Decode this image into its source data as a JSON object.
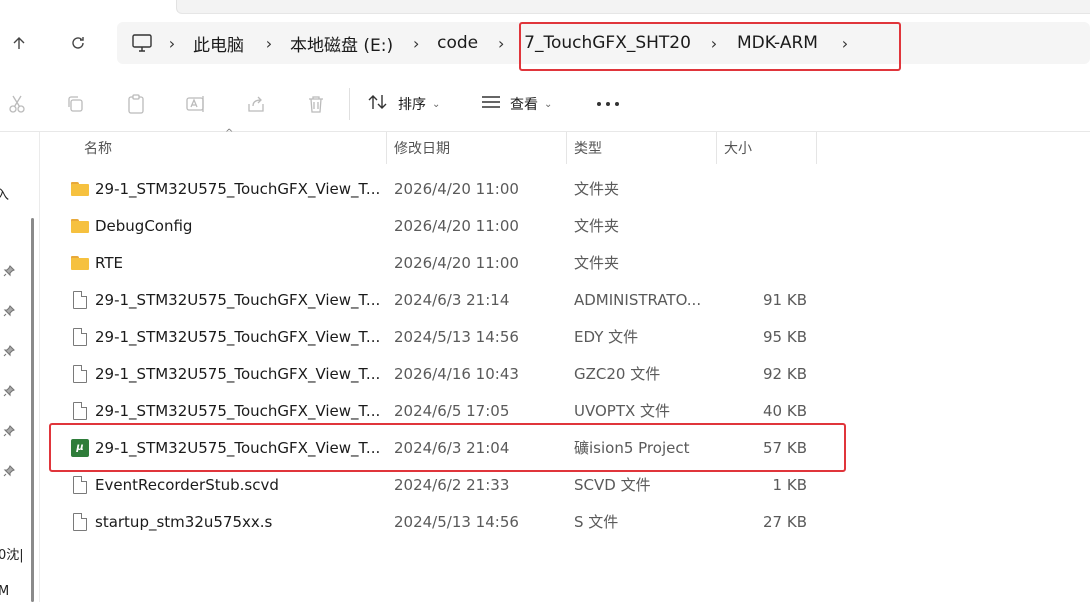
{
  "address": {
    "breadcrumbs": [
      "此电脑",
      "本地磁盘 (E:)",
      "code",
      "7_TouchGFX_SHT20",
      "MDK-ARM"
    ]
  },
  "toolbar": {
    "sort_label": "排序",
    "view_label": "查看"
  },
  "columns": {
    "name": "名称",
    "date": "修改日期",
    "type": "类型",
    "size": "大小"
  },
  "leftpane": {
    "text_1": "入",
    "text_2": "0沈|",
    "text_3": "M"
  },
  "files": [
    {
      "icon": "folder-icon",
      "name": "29-1_STM32U575_TouchGFX_View_T...",
      "date": "2026/4/20 11:00",
      "type": "文件夹",
      "size": ""
    },
    {
      "icon": "folder-icon",
      "name": "DebugConfig",
      "date": "2026/4/20 11:00",
      "type": "文件夹",
      "size": ""
    },
    {
      "icon": "folder-icon",
      "name": "RTE",
      "date": "2026/4/20 11:00",
      "type": "文件夹",
      "size": ""
    },
    {
      "icon": "file-icon",
      "name": "29-1_STM32U575_TouchGFX_View_T...",
      "date": "2024/6/3 21:14",
      "type": "ADMINISTRATO...",
      "size": "91 KB"
    },
    {
      "icon": "file-icon",
      "name": "29-1_STM32U575_TouchGFX_View_T...",
      "date": "2024/5/13 14:56",
      "type": "EDY 文件",
      "size": "95 KB"
    },
    {
      "icon": "file-icon",
      "name": "29-1_STM32U575_TouchGFX_View_T...",
      "date": "2026/4/16 10:43",
      "type": "GZC20 文件",
      "size": "92 KB"
    },
    {
      "icon": "file-icon",
      "name": "29-1_STM32U575_TouchGFX_View_T...",
      "date": "2024/6/5 17:05",
      "type": "UVOPTX 文件",
      "size": "40 KB"
    },
    {
      "icon": "uvision-project-icon",
      "name": "29-1_STM32U575_TouchGFX_View_T...",
      "date": "2024/6/3 21:04",
      "type": "礦ision5 Project",
      "size": "57 KB"
    },
    {
      "icon": "file-icon",
      "name": "EventRecorderStub.scvd",
      "date": "2024/6/2 21:33",
      "type": "SCVD 文件",
      "size": "1 KB"
    },
    {
      "icon": "file-icon",
      "name": "startup_stm32u575xx.s",
      "date": "2024/5/13 14:56",
      "type": "S 文件",
      "size": "27 KB"
    }
  ],
  "colors": {
    "highlight": "#e0353b",
    "folder": "#f6c13f",
    "uvision": "#2f7d3a"
  }
}
